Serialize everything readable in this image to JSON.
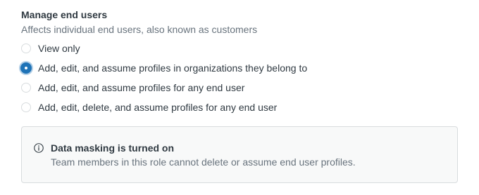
{
  "permission": {
    "title": "Manage end users",
    "hint": "Affects individual end users, also known as customers",
    "options": [
      {
        "label": "View only",
        "checked": false
      },
      {
        "label": "Add, edit, and assume profiles in organizations they belong to",
        "checked": true
      },
      {
        "label": "Add, edit, and assume profiles for any end user",
        "checked": false
      },
      {
        "label": "Add, edit, delete, and assume profiles for any end user",
        "checked": false
      }
    ],
    "selected_index": 1
  },
  "notice": {
    "icon": "info-icon",
    "title": "Data masking is turned on",
    "body": "Team members in this role cannot delete or assume end user profiles."
  },
  "colors": {
    "accent": "#1f73b7",
    "text": "#2f3941",
    "muted": "#68737d",
    "border": "#d8dcde",
    "notice_bg": "#f8f9f9"
  }
}
